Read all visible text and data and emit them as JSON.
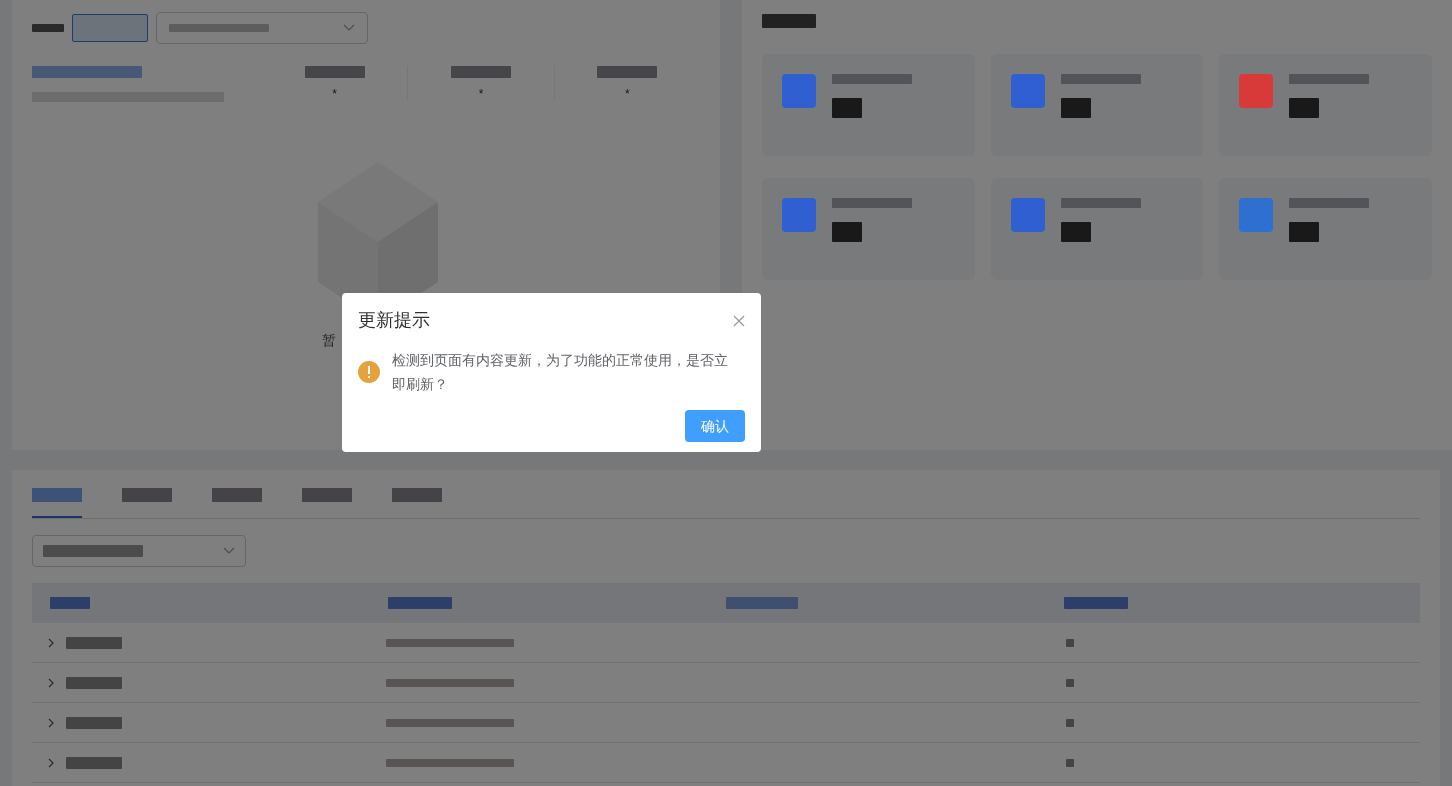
{
  "overview": {
    "stats": [
      {
        "value": "*"
      },
      {
        "value": "*"
      },
      {
        "value": "*"
      }
    ],
    "empty_state": {
      "text": "暂"
    }
  },
  "cards": [
    {
      "color": "#2f5fd0"
    },
    {
      "color": "#2f5fd0"
    },
    {
      "color": "#d83a3a"
    },
    {
      "color": "#2f5fd0"
    },
    {
      "color": "#2f5fd0"
    },
    {
      "color": "#2f6fd0"
    }
  ],
  "tabs": [
    {
      "selected": true
    },
    {
      "selected": false
    },
    {
      "selected": false
    },
    {
      "selected": false
    },
    {
      "selected": false
    }
  ],
  "table": {
    "rows": [
      {
        "expanded": false
      },
      {
        "expanded": false
      },
      {
        "expanded": false
      },
      {
        "expanded": false
      }
    ]
  },
  "dialog": {
    "title": "更新提示",
    "message": "检测到页面有内容更新，为了功能的正常使用，是否立即刷新？",
    "confirm": "确认"
  }
}
